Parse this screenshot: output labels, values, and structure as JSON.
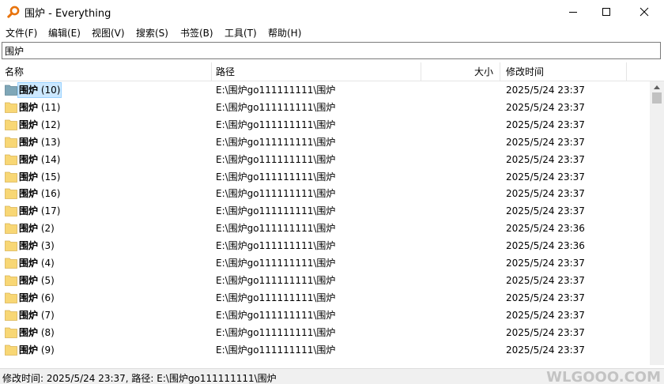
{
  "window": {
    "title": "围炉 - Everything",
    "app_icon": "magnifier-icon",
    "controls": [
      "minimize-icon",
      "maximize-icon",
      "close-icon"
    ]
  },
  "menu": [
    {
      "label": "文件(F)"
    },
    {
      "label": "编辑(E)"
    },
    {
      "label": "视图(V)"
    },
    {
      "label": "搜索(S)"
    },
    {
      "label": "书签(B)"
    },
    {
      "label": "工具(T)"
    },
    {
      "label": "帮助(H)"
    }
  ],
  "search": {
    "value": "围炉"
  },
  "columns": {
    "name": "名称",
    "path": "路径",
    "size": "大小",
    "modified": "修改时间"
  },
  "rows": [
    {
      "name_bold": "围炉",
      "name_rest": " (10)",
      "path": "E:\\围炉go111111111\\围炉",
      "size": "",
      "modified": "2025/5/24 23:37",
      "selected": true
    },
    {
      "name_bold": "围炉",
      "name_rest": " (11)",
      "path": "E:\\围炉go111111111\\围炉",
      "size": "",
      "modified": "2025/5/24 23:37"
    },
    {
      "name_bold": "围炉",
      "name_rest": " (12)",
      "path": "E:\\围炉go111111111\\围炉",
      "size": "",
      "modified": "2025/5/24 23:37"
    },
    {
      "name_bold": "围炉",
      "name_rest": " (13)",
      "path": "E:\\围炉go111111111\\围炉",
      "size": "",
      "modified": "2025/5/24 23:37"
    },
    {
      "name_bold": "围炉",
      "name_rest": " (14)",
      "path": "E:\\围炉go111111111\\围炉",
      "size": "",
      "modified": "2025/5/24 23:37"
    },
    {
      "name_bold": "围炉",
      "name_rest": " (15)",
      "path": "E:\\围炉go111111111\\围炉",
      "size": "",
      "modified": "2025/5/24 23:37"
    },
    {
      "name_bold": "围炉",
      "name_rest": " (16)",
      "path": "E:\\围炉go111111111\\围炉",
      "size": "",
      "modified": "2025/5/24 23:37"
    },
    {
      "name_bold": "围炉",
      "name_rest": " (17)",
      "path": "E:\\围炉go111111111\\围炉",
      "size": "",
      "modified": "2025/5/24 23:37"
    },
    {
      "name_bold": "围炉",
      "name_rest": " (2)",
      "path": "E:\\围炉go111111111\\围炉",
      "size": "",
      "modified": "2025/5/24 23:36"
    },
    {
      "name_bold": "围炉",
      "name_rest": " (3)",
      "path": "E:\\围炉go111111111\\围炉",
      "size": "",
      "modified": "2025/5/24 23:36"
    },
    {
      "name_bold": "围炉",
      "name_rest": " (4)",
      "path": "E:\\围炉go111111111\\围炉",
      "size": "",
      "modified": "2025/5/24 23:37"
    },
    {
      "name_bold": "围炉",
      "name_rest": " (5)",
      "path": "E:\\围炉go111111111\\围炉",
      "size": "",
      "modified": "2025/5/24 23:37"
    },
    {
      "name_bold": "围炉",
      "name_rest": " (6)",
      "path": "E:\\围炉go111111111\\围炉",
      "size": "",
      "modified": "2025/5/24 23:37"
    },
    {
      "name_bold": "围炉",
      "name_rest": " (7)",
      "path": "E:\\围炉go111111111\\围炉",
      "size": "",
      "modified": "2025/5/24 23:37"
    },
    {
      "name_bold": "围炉",
      "name_rest": " (8)",
      "path": "E:\\围炉go111111111\\围炉",
      "size": "",
      "modified": "2025/5/24 23:37"
    },
    {
      "name_bold": "围炉",
      "name_rest": " (9)",
      "path": "E:\\围炉go111111111\\围炉",
      "size": "",
      "modified": "2025/5/24 23:37"
    }
  ],
  "status": {
    "text": "修改时间: 2025/5/24 23:37, 路径: E:\\围炉go111111111\\围炉"
  },
  "watermark": "WLGOOO.COM",
  "colors": {
    "selection": "#cce8ff",
    "folder": "#f8d775",
    "app_icon": "#e8730c"
  }
}
